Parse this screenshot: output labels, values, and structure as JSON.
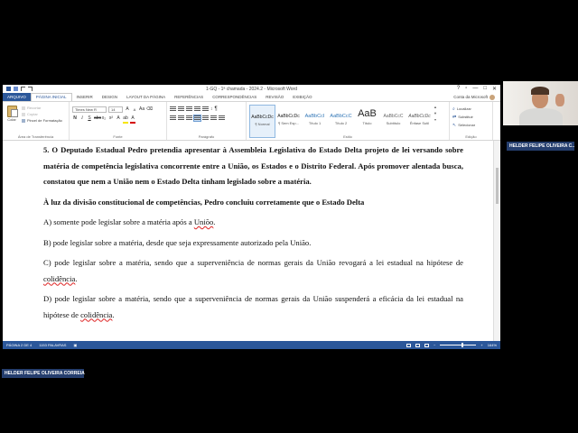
{
  "window": {
    "title": "1-GQ - 1ª chamada - 2024.2 - Microsoft Word",
    "controls": [
      "?",
      "▫",
      "—",
      "□",
      "✕"
    ]
  },
  "tabs": {
    "file": "ARQUIVO",
    "items": [
      "PÁGINA INICIAL",
      "INSERIR",
      "DESIGN",
      "LAYOUT DA PÁGINA",
      "REFERÊNCIAS",
      "CORRESPONDÊNCIAS",
      "REVISÃO",
      "EXIBIÇÃO"
    ],
    "active_index": 0,
    "account": "Conta da Microsoft"
  },
  "ribbon": {
    "clipboard": {
      "paste": "Colar",
      "cut": "Recortar",
      "copy": "Copiar",
      "format_painter": "Pincel de Formatação",
      "group_label": "Área de Transferência"
    },
    "font": {
      "name": "Times New R",
      "size": "14",
      "group_label": "Fonte",
      "highlight_color": "#f7e600",
      "font_color": "#d40000"
    },
    "paragraph": {
      "group_label": "Parágrafo",
      "pilcrow": "¶"
    },
    "styles": {
      "group_label": "Estilo",
      "items": [
        {
          "sample": "AaBbCcDc",
          "name": "¶ Normal"
        },
        {
          "sample": "AaBbCcDc",
          "name": "¶ Sem Esp..."
        },
        {
          "sample": "AaBbCcI",
          "name": "Título 1"
        },
        {
          "sample": "AaBbCcC",
          "name": "Título 2"
        },
        {
          "sample": "AaB",
          "name": "Título"
        },
        {
          "sample": "AaBbCcC",
          "name": "Subtítulo"
        },
        {
          "sample": "AaBbCcDc",
          "name": "Ênfase Sutil"
        }
      ]
    },
    "editing": {
      "group_label": "Edição",
      "find": "Localizar",
      "replace": "Substituir",
      "select": "Selecionar"
    }
  },
  "document": {
    "question_head": "5. O Deputado Estadual Pedro pretendia apresentar à Assembleia Legislativa do Estado Delta projeto de lei versando sobre matéria de competência legislativa concorrente entre a União, os Estados e o Distrito Federal. Após promover alentada busca, constatou que nem a União nem o Estado Delta tinham legislado sobre a matéria.",
    "question_stem": "À luz da divisão constitucional de competências, Pedro concluiu corretamente que o Estado Delta",
    "option_a_before": "A) somente pode legislar sobre a matéria após a ",
    "option_a_err": "Uniõo",
    "option_a_after": ".",
    "option_b": "B) pode legislar sobre a matéria, desde que seja expressamente autorizado pela União.",
    "option_c_before": "C) pode legislar sobre a matéria, sendo que a superveniência de normas gerais da União revogará a lei estadual na hipótese de ",
    "option_c_err": "colidência",
    "option_c_after": ".",
    "option_d_before": "D) pode legislar sobre a matéria, sendo que a superveniência de normas gerais da União suspenderá a eficácia da lei estadual na hipótese de ",
    "option_d_err": "colidência",
    "option_d_after": "."
  },
  "statusbar": {
    "page": "PÁGINA 2 DE 4",
    "words": "1153 PALAVRAS",
    "zoom": "164%"
  },
  "overlay": {
    "webcam_name": "HELDER FELIPE OLIVEIRA C...",
    "presenter_name": "HELDER FELIPE OLIVEIRA CORREIA"
  }
}
